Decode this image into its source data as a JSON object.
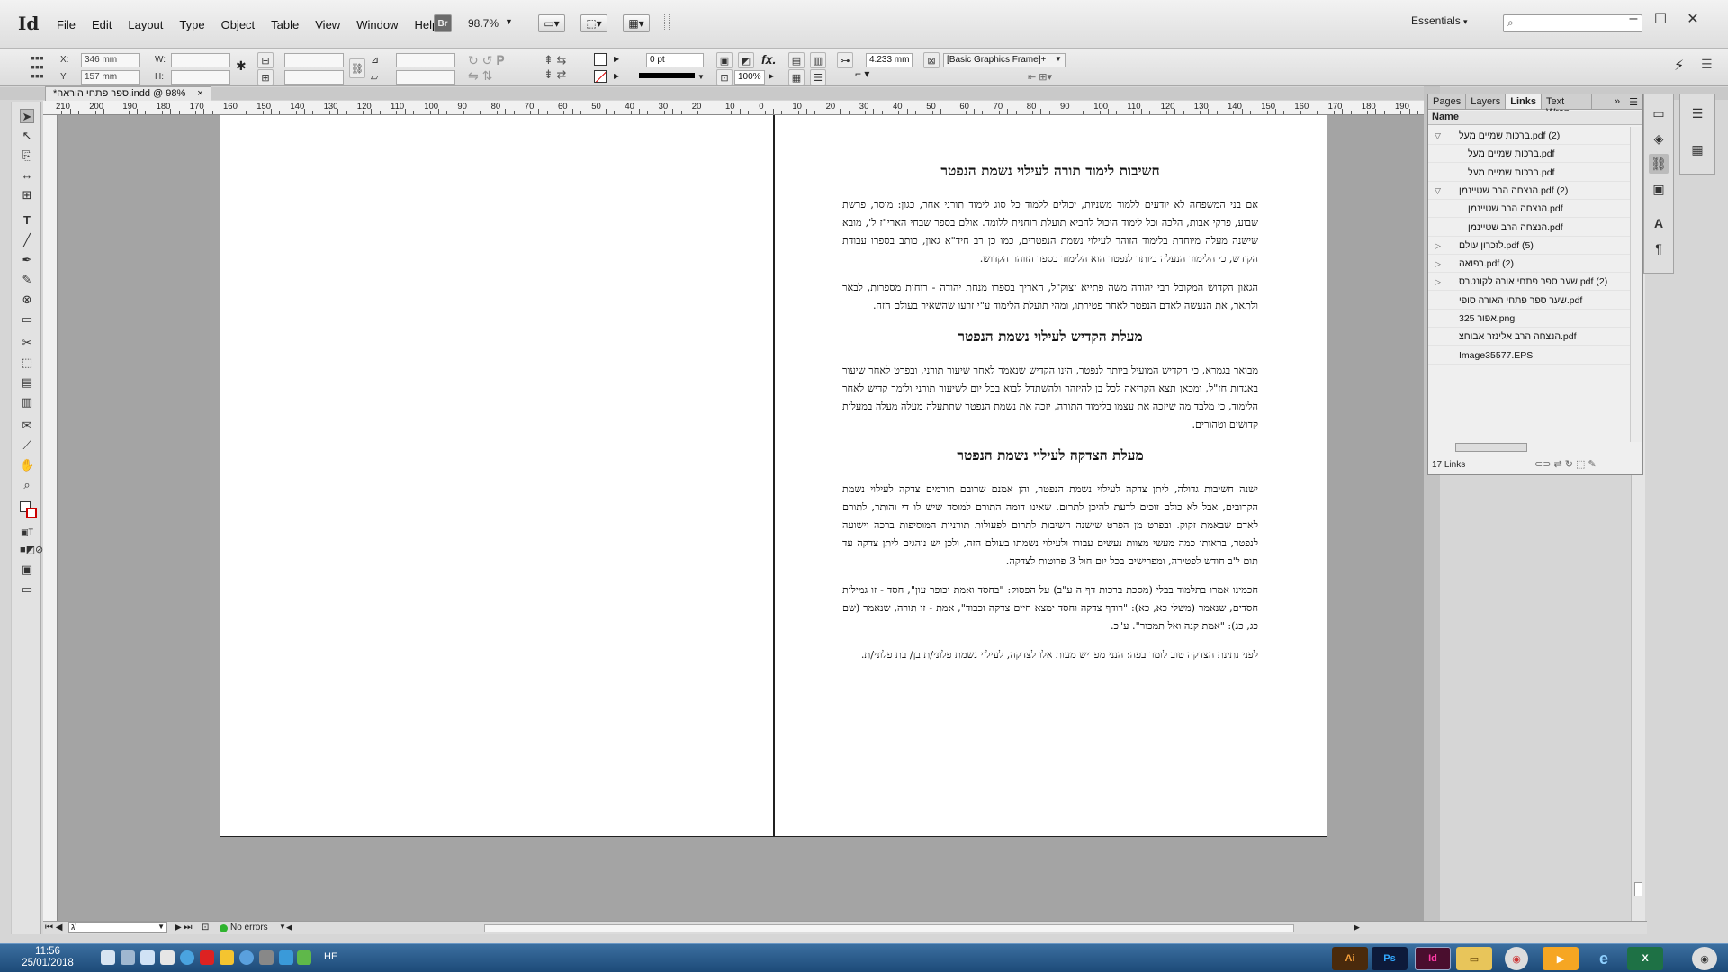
{
  "menubar": {
    "app_logo": "Id",
    "menu": [
      "File",
      "Edit",
      "Layout",
      "Type",
      "Object",
      "Table",
      "View",
      "Window",
      "Help"
    ],
    "bridge_label": "Br",
    "zoom": "98.7%",
    "workspace": "Essentials"
  },
  "controlbar": {
    "x_label": "X:",
    "x_value": "346 mm",
    "y_label": "Y:",
    "y_value": "157 mm",
    "w_label": "W:",
    "h_label": "H:",
    "stroke_weight": "0 pt",
    "scale_percent": "100%",
    "gap_value": "4.233 mm",
    "object_style": "[Basic Graphics Frame]+"
  },
  "document": {
    "tab_title": "*ספר פתחי הוראה.indd @ 98%",
    "ruler_labels": [
      "210",
      "200",
      "190",
      "180",
      "170",
      "160",
      "150",
      "140",
      "130",
      "120",
      "110",
      "100",
      "90",
      "80",
      "70",
      "60",
      "50",
      "40",
      "30",
      "20",
      "10",
      "0",
      "10",
      "20",
      "30",
      "40",
      "50",
      "60",
      "70",
      "80",
      "90",
      "100",
      "110",
      "120",
      "130",
      "140",
      "150",
      "160",
      "170",
      "180",
      "190"
    ]
  },
  "article": {
    "h1": "חשיבות לימוד תורה לעילוי נשמת הנפטר",
    "p1": "אם בני המשפחה לא יודעים ללמוד משניות, יכולים ללמוד כל סוג לימוד תורני אחר, כגון: מוסר, פרשת שבוע, פרקי אבות, הלכה וכל לימוד היכול להביא תועלת רוחנית ללומד. אולם בספר שבחי הארי\"ז ל', מובא שישנה מעלה מיוחדת בלימוד הזוהר לעילוי נשמת הנפטרים, כמו כן רב חיד\"א גאון, כותב בספרו עבודת הקודש, כי הלימוד הנעלה ביותר לנפטר הוא הלימוד בספר הזוהר הקדוש.",
    "p2": "הגאון הקדוש המקובל רבי יהודה משה פתייא זצוק\"ל, האריך בספרו מנחת יהודה - רוחות מספרות, לבאר ולתאר, את הנעשה לאדם הנפטר לאחר פטירתו, ומהי תועלת הלימוד ע\"י זרעו שהשאיר בעולם הזה.",
    "h2": "מעלת הקדיש לעילוי נשמת הנפטר",
    "p3": "מבואר בגמרא, כי הקדיש המועיל ביותר לנפטר, הינו הקדיש שנאמר לאחר שיעור תורני, ובפרט לאחר שיעור באגדות חז\"ל, ומכאן תצא הקריאה לכל בן להיזהר ולהשתדל לבוא בכל יום לשיעור תורני ולומר קדיש לאחר הלימוד, כי מלבד מה שיזכה את עצמו בלימוד התורה, יזכה את נשמת הנפטר שתתעלה מעלה מעלה במעלות קדושים וטהורים.",
    "h3": "מעלת הצדקה לעילוי נשמת הנפטר",
    "p4": "ישנה חשיבות גדולה, ליתן צדקה לעילוי נשמת הנפטר, והן אמנם שרובם תורמים צדקה לעילוי נשמת הקרובים, אבל לא כולם זוכים לדעת להיכן לתרום. שאינו דומה התורם למוסד שיש לו די והותר, לתורם לאדם שבאמת זקוק. ובפרט מן הפרט שישנה חשיבות לתרום לפעולות תורניות המוסיפות ברכה וישועה לנפטר, בראותו כמה מעשי מצוות נעשים עבורו ולעילוי נשמתו בעולם הזה, ולכן יש נוהגים ליתן צדקה עד תום י\"ב חודש לפטירה, ומפרישים בכל יום חול 3 פרוטות לצדקה.",
    "p5": "חכמינו אמרו בתלמוד בבלי (מסכת ברכות דף ה ע\"ב) על הפסוק: \"בחסד ואמת יכופר עון\", חסד - זו גמילות חסדים, שנאמר (משלי כא, כא): \"רודף צדקה וחסד ימצא חיים צדקה וכבוד\", אמת - זו תורה, שנאמר (שם כג, כג): \"אמת קנה ואל תמכור\". ע\"כ.",
    "p6": "לפני נתינת הצדקה טוב לומר בפה: הנני מפריש מעות אלו לצדקה, לעילוי נשמת פלוני/ת בן/ בת פלוני/ת."
  },
  "links_panel": {
    "tabs": [
      "Pages",
      "Layers",
      "Links",
      "Text Wrap"
    ],
    "active_tab": "Links",
    "column_header": "Name",
    "rows": [
      {
        "name": "ברכות שמיים מעל.pdf (2)",
        "indent": 0,
        "expanded": true
      },
      {
        "name": "ברכות שמיים מעל.pdf",
        "indent": 1
      },
      {
        "name": "ברכות שמיים מעל.pdf",
        "indent": 1
      },
      {
        "name": "הנצחה הרב שטיינמן.pdf (2)",
        "indent": 0,
        "expanded": true
      },
      {
        "name": "הנצחה הרב שטיינמן.pdf",
        "indent": 1
      },
      {
        "name": "הנצחה הרב שטיינמן.pdf",
        "indent": 1
      },
      {
        "name": "לזכרון עולם.pdf (5)",
        "indent": 0,
        "expanded": false
      },
      {
        "name": "רפואה.pdf (2)",
        "indent": 0,
        "expanded": false
      },
      {
        "name": "שער ספר פתחי אורה לקונטרס.pdf (2)",
        "indent": 0,
        "expanded": false
      },
      {
        "name": "שער ספר פתחי האורה סופי.pdf",
        "indent": 0
      },
      {
        "name": "אפור 325.png",
        "indent": 0
      },
      {
        "name": "הנצחה הרב אלינזר אבוחצ.pdf",
        "indent": 0
      },
      {
        "name": "Image35577.EPS",
        "indent": 0
      }
    ],
    "count": "17 Links"
  },
  "statusbar": {
    "page": "ג'",
    "preflight": "No errors"
  },
  "taskbar": {
    "time": "11:56",
    "date": "25/01/2018",
    "lang": "HE"
  }
}
